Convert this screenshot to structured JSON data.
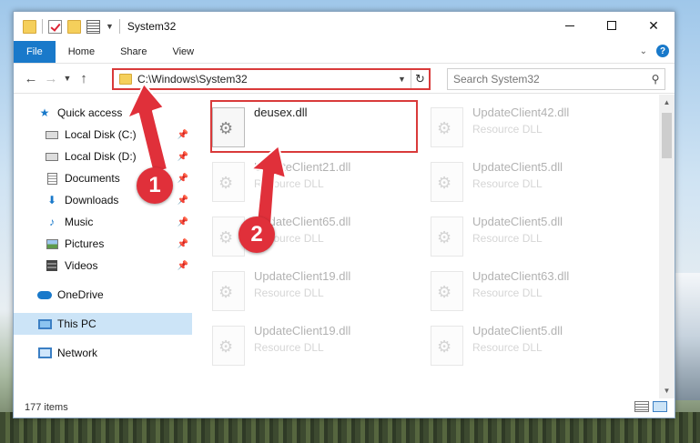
{
  "window": {
    "title": "System32"
  },
  "ribbon": {
    "tabs": [
      "File",
      "Home",
      "Share",
      "View"
    ]
  },
  "address_bar": {
    "path": "C:\\Windows\\System32"
  },
  "search": {
    "placeholder": "Search System32"
  },
  "sidebar": {
    "items": [
      {
        "label": "Quick access",
        "icon": "star-icon",
        "pinned": false
      },
      {
        "label": "Local Disk (C:)",
        "icon": "disk-icon",
        "pinned": true
      },
      {
        "label": "Local Disk (D:)",
        "icon": "disk-icon",
        "pinned": true
      },
      {
        "label": "Documents",
        "icon": "documents-icon",
        "pinned": true
      },
      {
        "label": "Downloads",
        "icon": "downloads-icon",
        "pinned": true
      },
      {
        "label": "Music",
        "icon": "music-icon",
        "pinned": true
      },
      {
        "label": "Pictures",
        "icon": "pictures-icon",
        "pinned": true
      },
      {
        "label": "Videos",
        "icon": "videos-icon",
        "pinned": true
      },
      {
        "label": "OneDrive",
        "icon": "onedrive-icon",
        "pinned": false
      },
      {
        "label": "This PC",
        "icon": "this-pc-icon",
        "pinned": false,
        "selected": true
      },
      {
        "label": "Network",
        "icon": "network-icon",
        "pinned": false
      }
    ]
  },
  "files": [
    {
      "name": "deusex.dll",
      "type": "",
      "highlighted": true
    },
    {
      "name": "UpdateClient42.dll",
      "type": "Resource DLL"
    },
    {
      "name": "UpdateClient21.dll",
      "type": "Resource DLL"
    },
    {
      "name": "UpdateClient5.dll",
      "type": "Resource DLL"
    },
    {
      "name": "UpdateClient65.dll",
      "type": "Resource DLL"
    },
    {
      "name": "UpdateClient5.dll",
      "type": "Resource DLL"
    },
    {
      "name": "UpdateClient19.dll",
      "type": "Resource DLL"
    },
    {
      "name": "UpdateClient63.dll",
      "type": "Resource DLL"
    },
    {
      "name": "UpdateClient19.dll",
      "type": "Resource DLL"
    },
    {
      "name": "UpdateClient5.dll",
      "type": "Resource DLL"
    }
  ],
  "status": {
    "item_count": "177 items"
  },
  "annotations": {
    "step1": "1",
    "step2": "2"
  },
  "colors": {
    "accent": "#1979ca",
    "highlight_red": "#d93a3a",
    "badge_red": "#e0303a",
    "selected_bg": "#cce4f7"
  }
}
